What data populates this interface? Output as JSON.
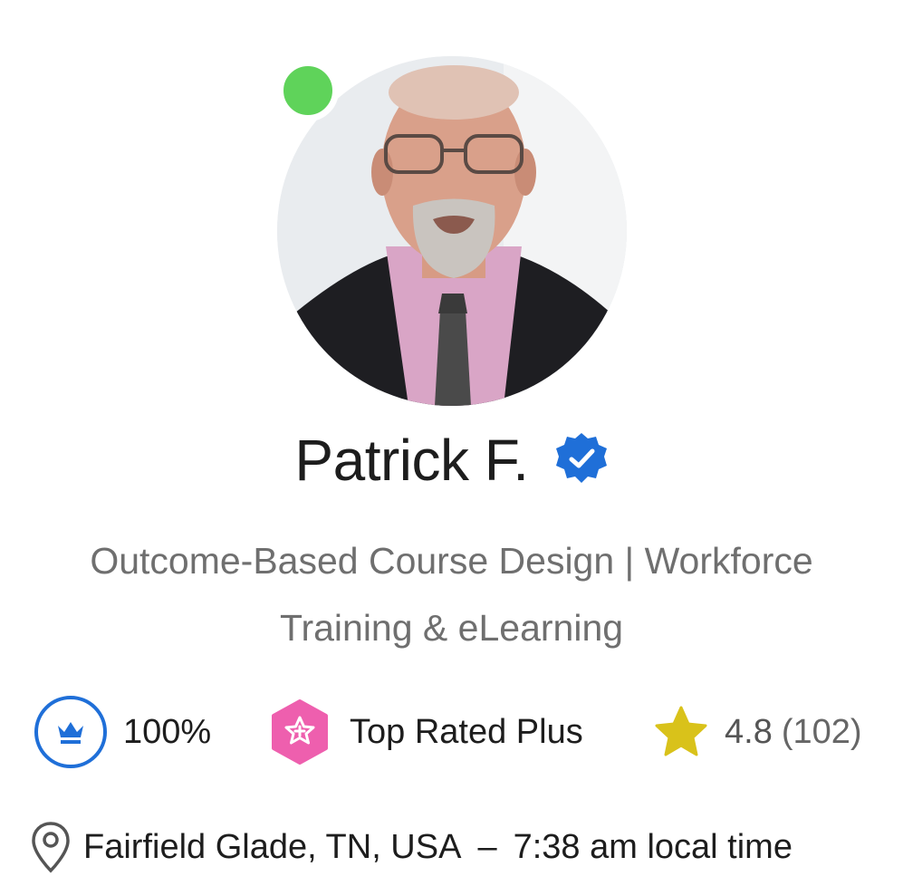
{
  "profile": {
    "name": "Patrick F.",
    "verified_icon": "verified-badge-icon",
    "online": true,
    "title_line1": "Outcome-Based Course Design | Workforce",
    "title_line2": "Training & eLearning"
  },
  "stats": {
    "job_success": "100%",
    "badge_label": "Top Rated Plus",
    "rating": "4.8",
    "review_count": "(102)"
  },
  "location": {
    "city": "Fairfield Glade, TN, USA",
    "separator": "–",
    "local_time": "7:38 am local time"
  },
  "colors": {
    "online": "#5fd35a",
    "verified": "#1f6fd8",
    "jss_ring": "#1f6fd8",
    "top_rated_plus": "#ee5fae",
    "star": "#d9c21a",
    "secondary_text": "#6f6f6f"
  }
}
